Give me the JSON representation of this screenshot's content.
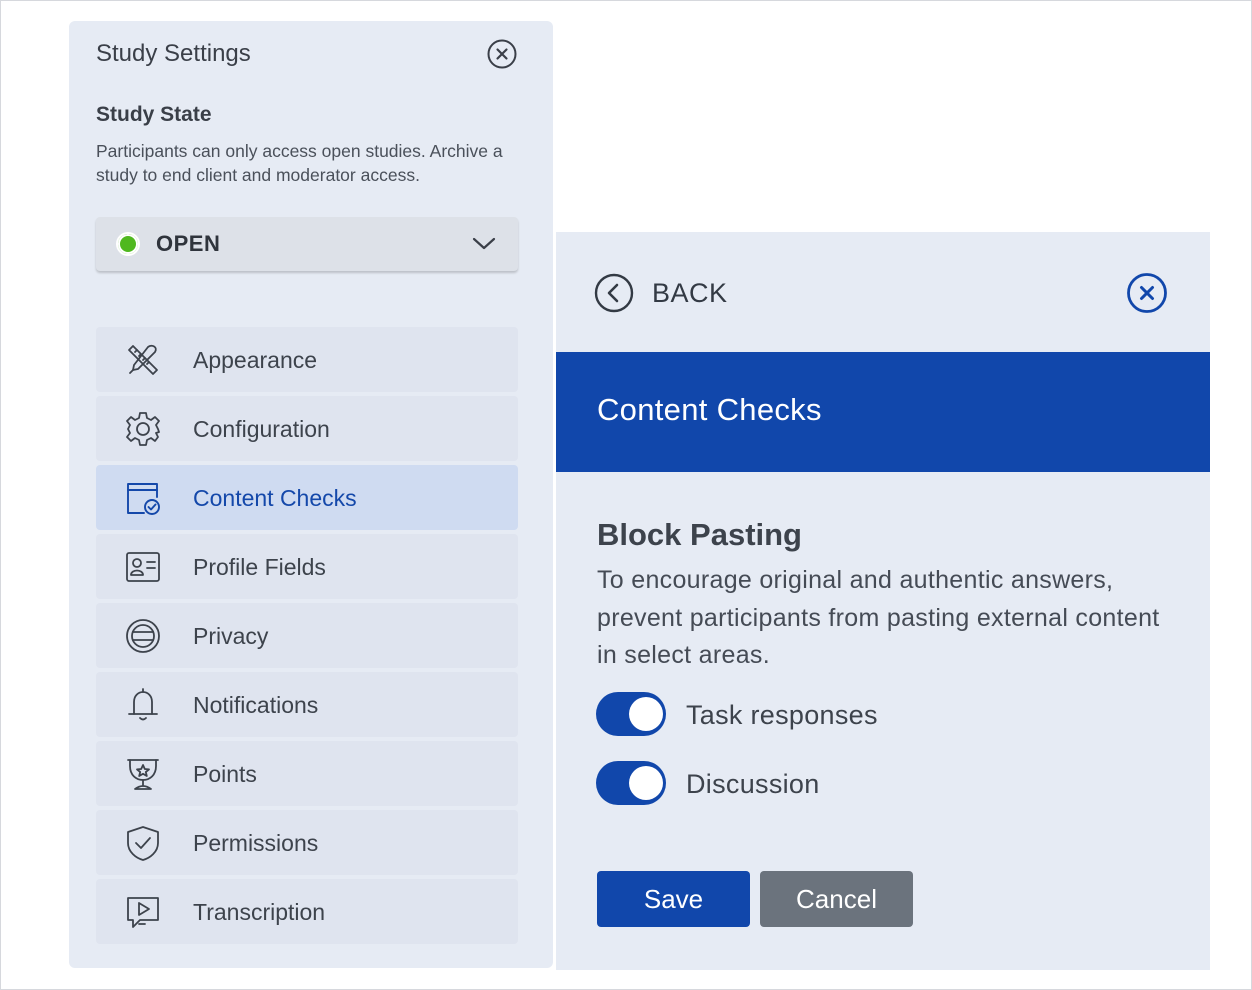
{
  "settings": {
    "title": "Study Settings",
    "state_title": "Study State",
    "state_description": "Participants can only access open studies. Archive a study to end client and moderator access.",
    "state_value": "OPEN",
    "state_color": "#4fb81f",
    "items": [
      {
        "label": "Appearance",
        "icon": "paintbrush-ruler-icon"
      },
      {
        "label": "Configuration",
        "icon": "gear-icon"
      },
      {
        "label": "Content Checks",
        "icon": "calendar-check-icon",
        "active": true
      },
      {
        "label": "Profile Fields",
        "icon": "id-card-icon"
      },
      {
        "label": "Privacy",
        "icon": "privacy-globe-icon"
      },
      {
        "label": "Notifications",
        "icon": "bell-icon"
      },
      {
        "label": "Points",
        "icon": "trophy-icon"
      },
      {
        "label": "Permissions",
        "icon": "shield-check-icon"
      },
      {
        "label": "Transcription",
        "icon": "video-chat-icon"
      }
    ]
  },
  "detail": {
    "back_label": "BACK",
    "title": "Content Checks",
    "section_title": "Block Pasting",
    "section_description": "To encourage original and authentic answers, prevent participants from pasting external content in select areas.",
    "toggles": [
      {
        "label": "Task responses",
        "on": true
      },
      {
        "label": "Discussion",
        "on": true
      }
    ],
    "save_label": "Save",
    "cancel_label": "Cancel"
  },
  "colors": {
    "accent": "#1147ab",
    "panel_bg": "#e6ebf4",
    "active_item_bg": "#cfdbf1",
    "cancel_bg": "#6b737d"
  }
}
